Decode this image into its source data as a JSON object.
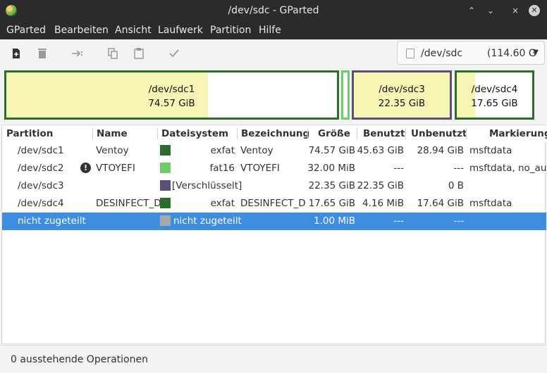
{
  "window": {
    "title": "/dev/sdc - GParted",
    "controls": [
      "⌃",
      "⌄",
      "×"
    ]
  },
  "menubar": {
    "items": [
      "GParted",
      "Bearbeiten",
      "Ansicht",
      "Laufwerk",
      "Partition",
      "Hilfe"
    ]
  },
  "toolbar": {
    "icons": [
      "new-partition-icon",
      "delete-icon",
      "resize-move-icon",
      "copy-icon",
      "paste-icon",
      "apply-icon"
    ]
  },
  "device": {
    "name": "/dev/sdc",
    "size": "(114.60 G"
  },
  "diskmap": [
    {
      "name": "/dev/sdc1",
      "size": "74.57 GiB",
      "used_fraction": 0.61,
      "color": "#2b6e2b"
    },
    {
      "name": "",
      "size": "",
      "used_fraction": 0,
      "color": "#6dcd6d"
    },
    {
      "name": "/dev/sdc3",
      "size": "22.35 GiB",
      "used_fraction": 1.0,
      "color": "#5a4f7a"
    },
    {
      "name": "/dev/sdc4",
      "size": "17.65 GiB",
      "used_fraction": 0.24,
      "color": "#2b6e2b"
    }
  ],
  "columns": [
    "Partition",
    "Name",
    "Dateisystem",
    "Bezeichnung",
    "Größe",
    "Benutzt",
    "Unbenutzt",
    "Markierungen"
  ],
  "rows": [
    {
      "partition": "/dev/sdc1",
      "name": "Ventoy",
      "warn": false,
      "fs_color": "#2b6e2b",
      "fs": "exfat",
      "label": "Ventoy",
      "size": "74.57 GiB",
      "used": "45.63 GiB",
      "unused": "28.94 GiB",
      "flags": "msftdata"
    },
    {
      "partition": "/dev/sdc2",
      "name": "VTOYEFI",
      "warn": true,
      "fs_color": "#6dcd6d",
      "fs": "fat16",
      "label": "VTOYEFI",
      "size": "32.00 MiB",
      "used": "---",
      "unused": "---",
      "flags": "msftdata, no_auto"
    },
    {
      "partition": "/dev/sdc3",
      "name": "",
      "warn": false,
      "fs_color": "#5a4f7a",
      "fs": "[Verschlüsselt]",
      "label": "",
      "size": "22.35 GiB",
      "used": "22.35 GiB",
      "unused": "0 B",
      "flags": ""
    },
    {
      "partition": "/dev/sdc4",
      "name": "DESINFECT_D",
      "warn": false,
      "fs_color": "#2b6e2b",
      "fs": "exfat",
      "label": "DESINFECT_D",
      "size": "17.65 GiB",
      "used": "4.16 MiB",
      "unused": "17.64 GiB",
      "flags": "msftdata"
    },
    {
      "partition": "nicht zugeteilt",
      "name": "",
      "warn": false,
      "fs_color": "#a8a8a8",
      "fs": "nicht zugeteilt",
      "label": "",
      "size": "1.00 MiB",
      "used": "---",
      "unused": "---",
      "flags": "",
      "selected": true
    }
  ],
  "statusbar": {
    "text": "0 ausstehende Operationen"
  }
}
